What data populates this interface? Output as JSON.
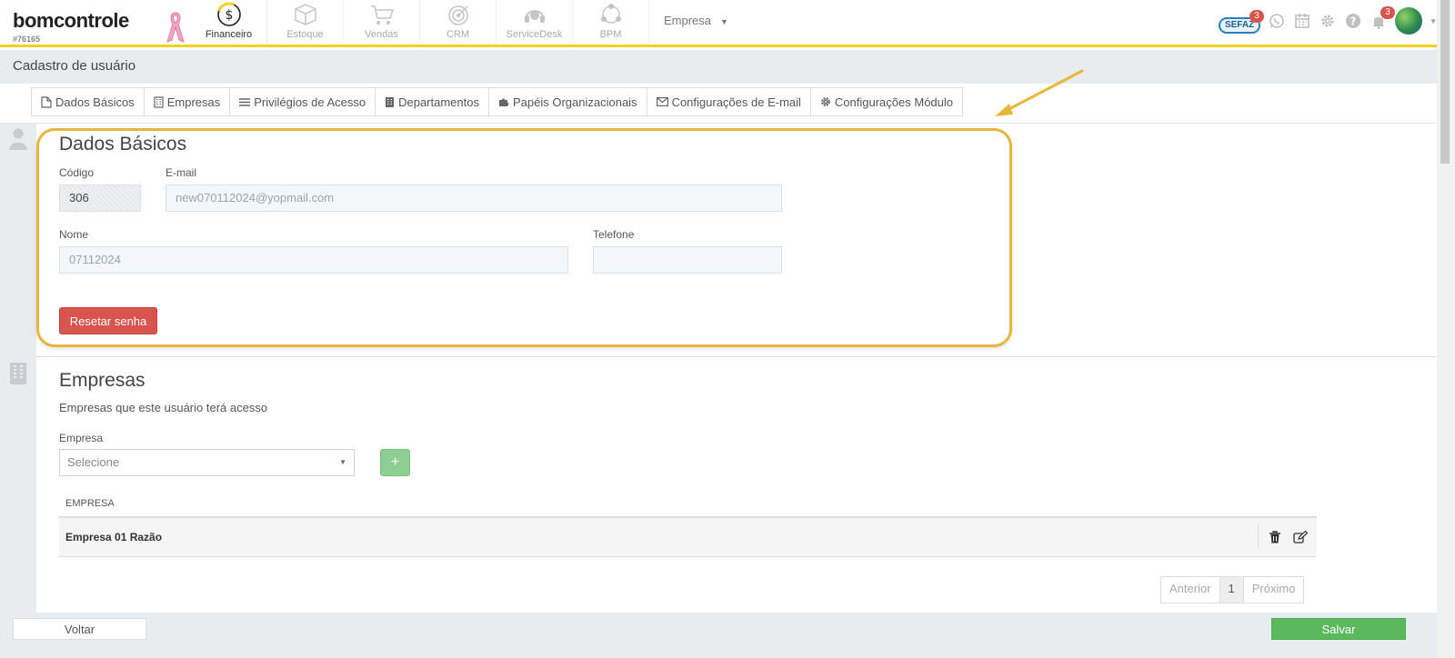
{
  "brand": {
    "logo": "bomcontrole",
    "account_id": "#76165"
  },
  "modules": [
    {
      "label": "Financeiro",
      "icon": "money-circle-icon",
      "active": true
    },
    {
      "label": "Estoque",
      "icon": "box-icon",
      "active": false
    },
    {
      "label": "Vendas",
      "icon": "cart-icon",
      "active": false
    },
    {
      "label": "CRM",
      "icon": "target-icon",
      "active": false
    },
    {
      "label": "ServiceDesk",
      "icon": "headset-icon",
      "active": false
    },
    {
      "label": "BPM",
      "icon": "process-icon",
      "active": false
    }
  ],
  "company_selector": {
    "label": "Empresa"
  },
  "top_right": {
    "sefaz_label": "SEFAZ",
    "sefaz_badge": "3",
    "notifications_badge": "3"
  },
  "page": {
    "title": "Cadastro de usuário"
  },
  "tabs": [
    {
      "label": "Dados Básicos",
      "icon": "file-icon"
    },
    {
      "label": "Empresas",
      "icon": "building-icon"
    },
    {
      "label": "Privilégios de Acesso",
      "icon": "list-icon"
    },
    {
      "label": "Departamentos",
      "icon": "building-icon"
    },
    {
      "label": "Papéis Organizacionais",
      "icon": "puzzle-icon"
    },
    {
      "label": "Configurações de E-mail",
      "icon": "envelope-icon"
    },
    {
      "label": "Configurações Módulo",
      "icon": "gear-icon"
    }
  ],
  "basic": {
    "title": "Dados Básicos",
    "code_label": "Código",
    "code_value": "306",
    "email_label": "E-mail",
    "email_value": "new070112024@yopmail.com",
    "name_label": "Nome",
    "name_value": "07112024",
    "phone_label": "Telefone",
    "phone_value": "",
    "reset_button": "Resetar senha"
  },
  "companies": {
    "title": "Empresas",
    "subtitle": "Empresas que este usuário terá acesso",
    "select_label": "Empresa",
    "select_value": "Selecione",
    "add_button": "+",
    "column_header": "EMPRESA",
    "rows": [
      {
        "name": "Empresa 01 Razão"
      }
    ]
  },
  "pagination": {
    "prev": "Anterior",
    "current": "1",
    "next": "Próximo"
  },
  "footer": {
    "back_button": "Voltar",
    "save_button": "Salvar"
  },
  "colors": {
    "accent_yellow": "#f2d21b",
    "highlight_border": "#e6b73a",
    "danger": "#d9534f",
    "success": "#5cb85c"
  }
}
